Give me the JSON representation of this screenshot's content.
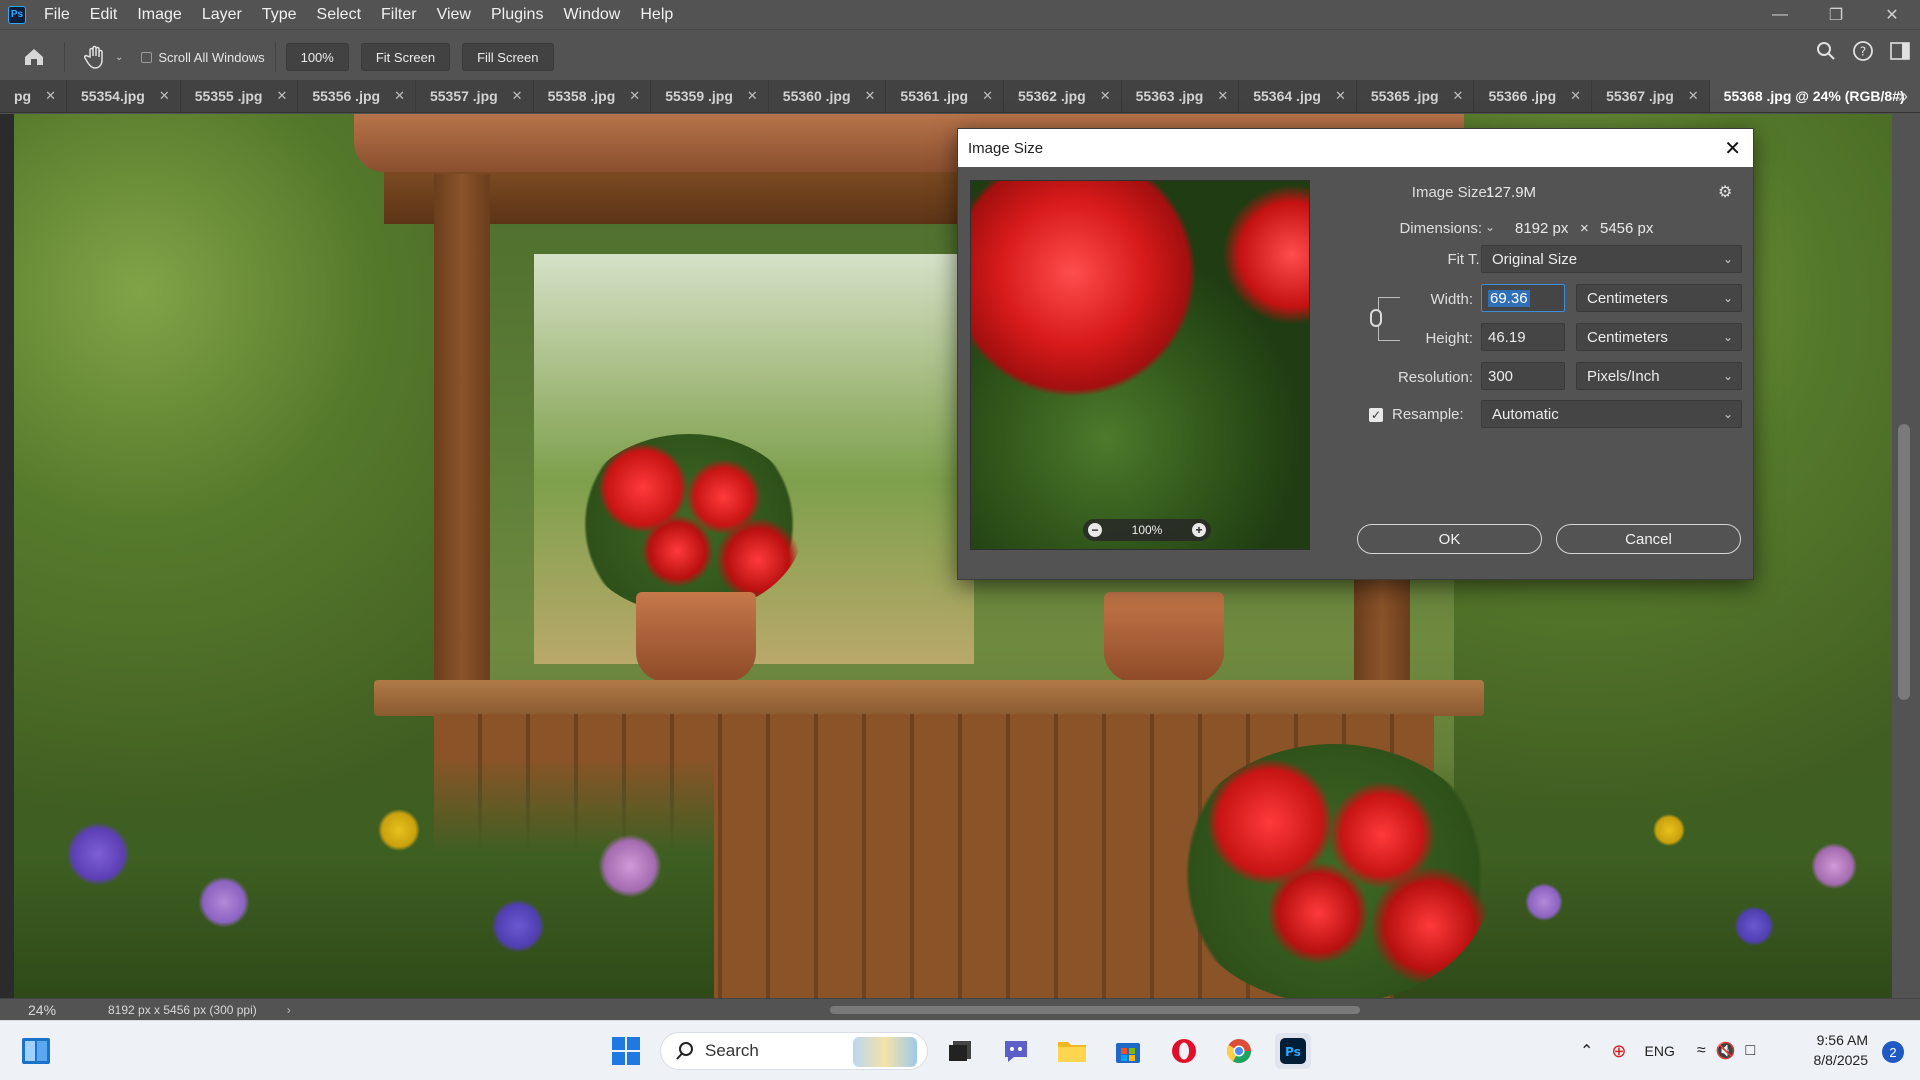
{
  "app": {
    "logo": "Ps",
    "menu": [
      "File",
      "Edit",
      "Image",
      "Layer",
      "Type",
      "Select",
      "Filter",
      "View",
      "Plugins",
      "Window",
      "Help"
    ]
  },
  "options_bar": {
    "scroll_all_windows": "Scroll All Windows",
    "scroll_all_checked": false,
    "zoom_button": "100%",
    "fit_screen": "Fit Screen",
    "fill_screen": "Fill Screen"
  },
  "tabs": [
    {
      "label": "pg"
    },
    {
      "label": "55354.jpg"
    },
    {
      "label": "55355 .jpg"
    },
    {
      "label": "55356 .jpg"
    },
    {
      "label": "55357 .jpg"
    },
    {
      "label": "55358 .jpg"
    },
    {
      "label": "55359 .jpg"
    },
    {
      "label": "55360 .jpg"
    },
    {
      "label": "55361 .jpg"
    },
    {
      "label": "55362 .jpg"
    },
    {
      "label": "55363 .jpg"
    },
    {
      "label": "55364 .jpg"
    },
    {
      "label": "55365 .jpg"
    },
    {
      "label": "55366 .jpg"
    },
    {
      "label": "55367 .jpg"
    },
    {
      "label": "55368 .jpg @ 24% (RGB/8#)",
      "active": true
    }
  ],
  "dialog": {
    "title": "Image Size",
    "image_size_label": "Image Size:",
    "image_size_value": "127.9M",
    "dimensions_label": "Dimensions:",
    "dimensions_width": "8192 px",
    "dimensions_x": "×",
    "dimensions_height": "5456 px",
    "fit_to_label": "Fit T...",
    "fit_to_value": "Original Size",
    "width_label": "Width:",
    "width_value": "69.36",
    "width_unit": "Centimeters",
    "height_label": "Height:",
    "height_value": "46.19",
    "height_unit": "Centimeters",
    "resolution_label": "Resolution:",
    "resolution_value": "300",
    "resolution_unit": "Pixels/Inch",
    "resample_label": "Resample:",
    "resample_checked": true,
    "resample_value": "Automatic",
    "preview_zoom": "100%",
    "ok": "OK",
    "cancel": "Cancel"
  },
  "status_bar": {
    "zoom": "24%",
    "doc_info": "8192 px x 5456 px (300 ppi)"
  },
  "taskbar": {
    "search_placeholder": "Search",
    "language": "ENG",
    "time": "9:56 AM",
    "date": "8/8/2025",
    "notifications": "2"
  },
  "colors": {
    "ui_panel": "#535353",
    "tab_bar": "#424242",
    "accent_blue": "#2f6fb7",
    "taskbar": "#eef1f6"
  }
}
